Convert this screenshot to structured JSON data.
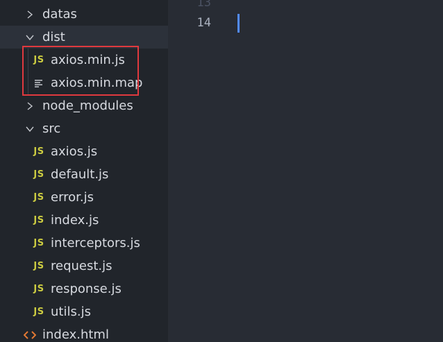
{
  "explorer": {
    "items": [
      {
        "label": "datas",
        "kind": "folder-collapsed"
      },
      {
        "label": "dist",
        "kind": "folder-expanded"
      },
      {
        "label": "axios.min.js",
        "kind": "js-file",
        "icon_text": "JS"
      },
      {
        "label": "axios.min.map",
        "kind": "map-file"
      },
      {
        "label": "node_modules",
        "kind": "folder-collapsed"
      },
      {
        "label": "src",
        "kind": "folder-expanded"
      },
      {
        "label": "axios.js",
        "kind": "js-file",
        "icon_text": "JS"
      },
      {
        "label": "default.js",
        "kind": "js-file",
        "icon_text": "JS"
      },
      {
        "label": "error.js",
        "kind": "js-file",
        "icon_text": "JS"
      },
      {
        "label": "index.js",
        "kind": "js-file",
        "icon_text": "JS"
      },
      {
        "label": "interceptors.js",
        "kind": "js-file",
        "icon_text": "JS"
      },
      {
        "label": "request.js",
        "kind": "js-file",
        "icon_text": "JS"
      },
      {
        "label": "response.js",
        "kind": "js-file",
        "icon_text": "JS"
      },
      {
        "label": "utils.js",
        "kind": "js-file",
        "icon_text": "JS"
      },
      {
        "label": "index.html",
        "kind": "html-file"
      }
    ]
  },
  "editor": {
    "line_numbers": [
      "13",
      "14"
    ]
  },
  "colors": {
    "sidebar_bg": "#21252b",
    "editor_bg": "#282c34",
    "js_icon": "#cbcb41",
    "html_icon": "#e37933",
    "highlight_border": "#e0393e",
    "cursor": "#528bff"
  }
}
